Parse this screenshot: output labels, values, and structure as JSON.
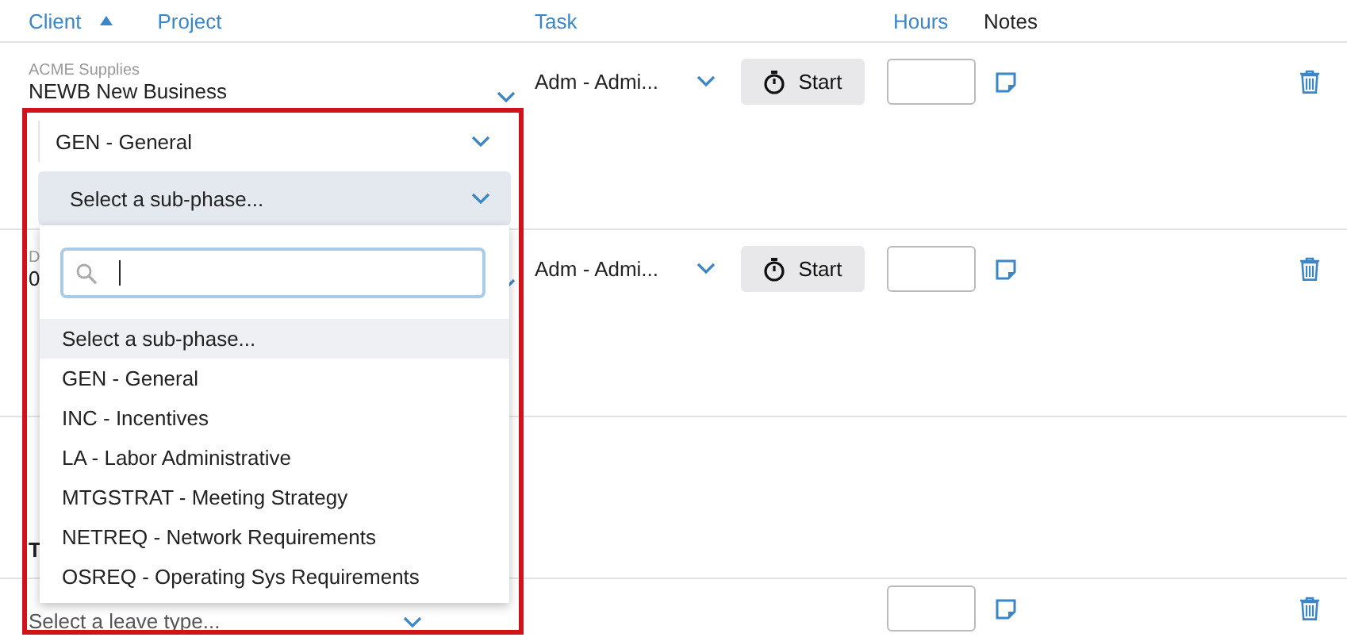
{
  "header": {
    "columns": [
      {
        "label": "Client",
        "sortable": true,
        "sorted": true
      },
      {
        "label": "Project",
        "sortable": true,
        "sorted": false
      },
      {
        "label": "Task",
        "sortable": true,
        "sorted": false
      },
      {
        "label": "Hours",
        "sortable": true,
        "sorted": false
      },
      {
        "label": "Notes",
        "sortable": false,
        "sorted": false
      }
    ]
  },
  "rows": [
    {
      "client": "ACME Supplies",
      "project": "NEWB New Business",
      "task": "Adm - Admi...",
      "start": "Start"
    },
    {
      "client": "D",
      "project": "0",
      "task": "Adm - Admi...",
      "start": "Start"
    }
  ],
  "section": {
    "title": "T",
    "leave_placeholder": "Select a leave type..."
  },
  "popup": {
    "phase": "GEN - General",
    "subphase_placeholder": "Select a sub-phase...",
    "options": [
      {
        "label": "Select a sub-phase...",
        "selected": true
      },
      {
        "label": "GEN - General",
        "selected": false
      },
      {
        "label": "INC - Incentives",
        "selected": false
      },
      {
        "label": "LA - Labor Administrative",
        "selected": false
      },
      {
        "label": "MTGSTRAT - Meeting Strategy",
        "selected": false
      },
      {
        "label": "NETREQ - Network Requirements",
        "selected": false
      },
      {
        "label": "OSREQ - Operating Sys Requirements",
        "selected": false
      }
    ]
  }
}
